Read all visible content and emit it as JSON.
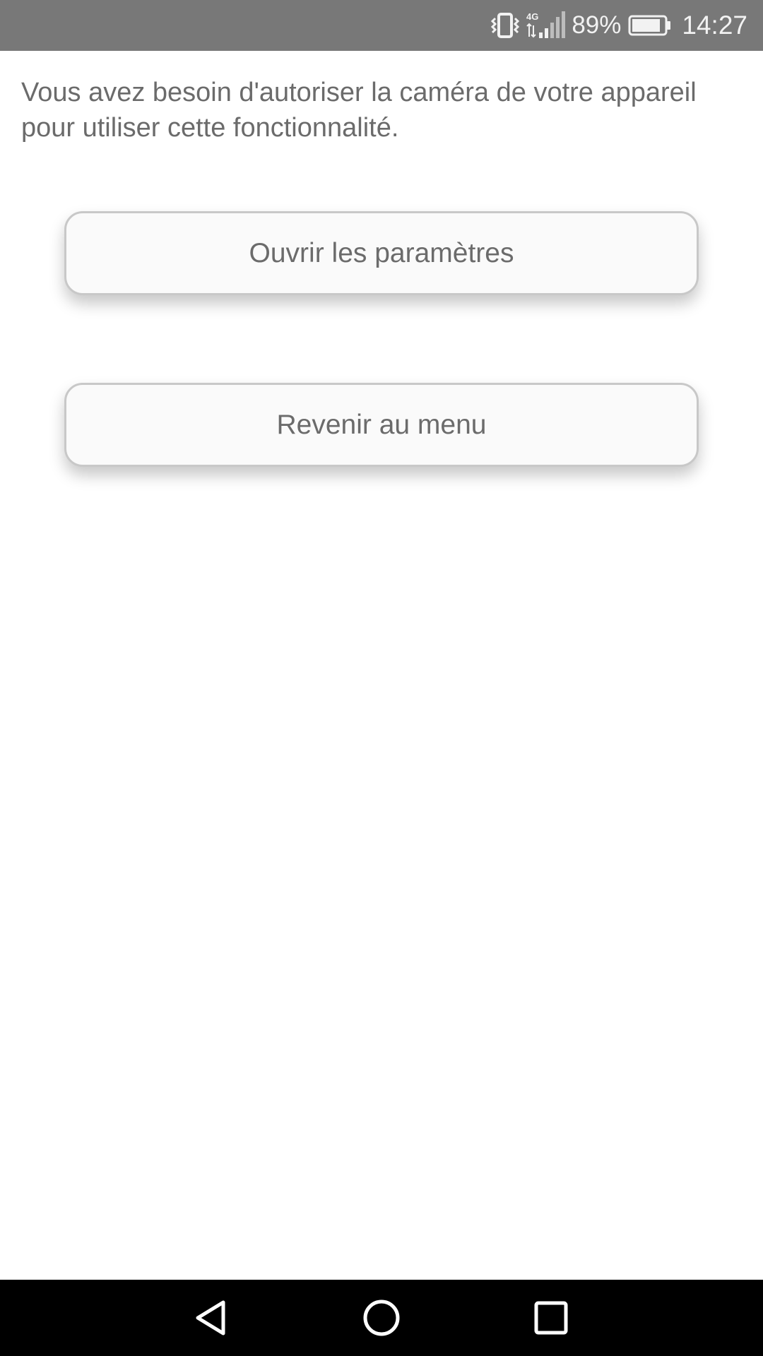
{
  "status_bar": {
    "network_label": "4G",
    "battery_percent": "89%",
    "time": "14:27",
    "icons": [
      "vibrate-icon",
      "signal-icon",
      "battery-icon"
    ],
    "battery_level": 0.89,
    "colors": {
      "background": "#787878",
      "foreground": "#f2f2f2"
    }
  },
  "main": {
    "message": "Vous avez besoin d'autoriser la caméra de votre appareil pour utiliser cette fonctionnalité.",
    "buttons": {
      "open_settings": "Ouvrir les paramètres",
      "back_to_menu": "Revenir au menu"
    }
  },
  "nav_bar": {
    "icons": [
      "back-icon",
      "home-icon",
      "recent-apps-icon"
    ],
    "colors": {
      "background": "#000000",
      "foreground": "#ffffff"
    }
  }
}
